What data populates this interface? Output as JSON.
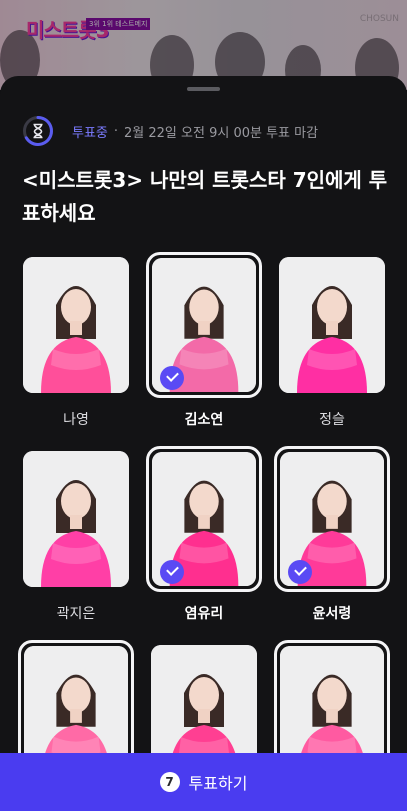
{
  "banner": {
    "logo_text": "미스트롯3",
    "tag_text": "3위 1위 테스트메지",
    "channel_text": "CHOSUN"
  },
  "sheet": {
    "status_label": "투표중",
    "status_separator": "·",
    "deadline": "2월 22일 오전 9시 00분 투표 마감",
    "title": "<미스트롯3> 나만의 트롯스타 7인에게 투표하세요"
  },
  "candidates": [
    {
      "name": "나영",
      "selected": false,
      "outfit_color": "#ff4f9a"
    },
    {
      "name": "김소연",
      "selected": true,
      "outfit_color": "#f36aa8"
    },
    {
      "name": "정슬",
      "selected": false,
      "outfit_color": "#ff2fa3"
    },
    {
      "name": "곽지은",
      "selected": false,
      "outfit_color": "#ff3fa6"
    },
    {
      "name": "염유리",
      "selected": true,
      "outfit_color": "#ff2f8f"
    },
    {
      "name": "윤서령",
      "selected": true,
      "outfit_color": "#ff3a99"
    },
    {
      "name": "",
      "selected": true,
      "outfit_color": "#ff6aa6"
    },
    {
      "name": "",
      "selected": false,
      "outfit_color": "#ff3f92"
    },
    {
      "name": "",
      "selected": true,
      "outfit_color": "#ff5aa1"
    }
  ],
  "vote_button": {
    "count": "7",
    "label": "투표하기"
  },
  "colors": {
    "accent": "#4a3cf0",
    "check": "#5a4af4",
    "status": "#7b7bff",
    "sheet_bg": "#131315"
  },
  "icons": {
    "status": "hourglass-timer-icon",
    "check": "check-icon"
  }
}
